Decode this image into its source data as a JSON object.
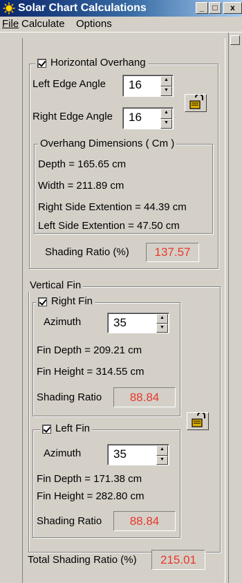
{
  "window": {
    "title": "Solar Chart Calculations",
    "controls": {
      "minimize": "_",
      "maximize": "□",
      "close": "x"
    }
  },
  "menu": {
    "file": "File",
    "calculate": "Calculate",
    "options": "Options"
  },
  "horizontal_overhang": {
    "label": "Horizontal Overhang",
    "checked": true,
    "left_edge_angle_label": "Left Edge Angle",
    "left_edge_angle_value": "16",
    "right_edge_angle_label": "Right Edge Angle",
    "right_edge_angle_value": "16",
    "dimensions_title": "Overhang Dimensions ( Cm )",
    "depth": "Depth = 165.65 cm",
    "width": "Width = 211.89 cm",
    "right_side_extension": "Right Side Extention = 44.39 cm",
    "left_side_extension": "Left Side Extention = 47.50 cm",
    "shading_ratio_label": "Shading Ratio (%)",
    "shading_ratio_value": "137.57"
  },
  "vertical_fin": {
    "label": "Vertical Fin",
    "right_fin": {
      "label": "Right Fin",
      "checked": true,
      "azimuth_label": "Azimuth",
      "azimuth_value": "35",
      "fin_depth": "Fin Depth = 209.21 cm",
      "fin_height": "Fin Height = 314.55 cm",
      "shading_ratio_label": "Shading Ratio",
      "shading_ratio_value": "88.84"
    },
    "left_fin": {
      "label": "Left Fin",
      "checked": true,
      "azimuth_label": "Azimuth",
      "azimuth_value": "35",
      "fin_depth": "Fin Depth = 171.38 cm",
      "fin_height": "Fin Height = 282.80 cm",
      "shading_ratio_label": "Shading Ratio",
      "shading_ratio_value": "88.84"
    }
  },
  "total": {
    "label": "Total Shading Ratio (%)",
    "value": "215.01"
  },
  "colors": {
    "readout_text": "#e8372c",
    "face": "#d4d0c8",
    "title_start": "#0a246a"
  },
  "icons": [
    "sun-icon",
    "lock-icon"
  ]
}
